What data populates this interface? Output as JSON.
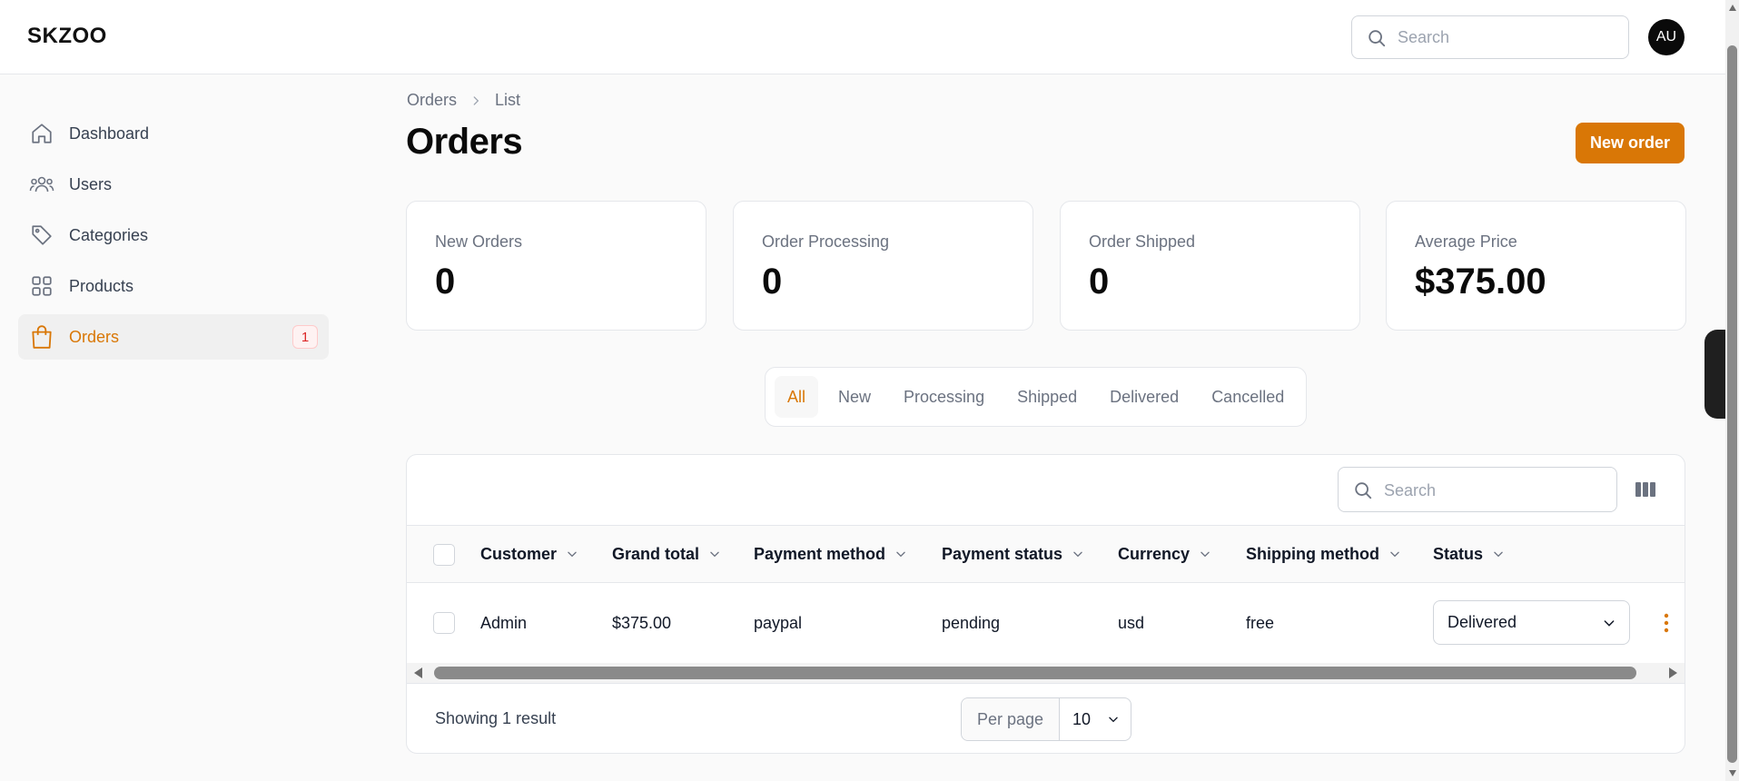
{
  "app": {
    "brand": "SKZOO",
    "avatar_initials": "AU"
  },
  "search": {
    "placeholder": "Search"
  },
  "sidebar": {
    "items": [
      {
        "label": "Dashboard",
        "icon": "home-icon"
      },
      {
        "label": "Users",
        "icon": "users-icon"
      },
      {
        "label": "Categories",
        "icon": "tag-icon"
      },
      {
        "label": "Products",
        "icon": "grid-icon"
      },
      {
        "label": "Orders",
        "icon": "shopping-bag-icon",
        "badge": "1",
        "active": true
      }
    ]
  },
  "breadcrumb": {
    "items": [
      "Orders",
      "List"
    ]
  },
  "page": {
    "title": "Orders",
    "new_button": "New order"
  },
  "stats": [
    {
      "label": "New Orders",
      "value": "0"
    },
    {
      "label": "Order Processing",
      "value": "0"
    },
    {
      "label": "Order Shipped",
      "value": "0"
    },
    {
      "label": "Average Price",
      "value": "$375.00"
    }
  ],
  "tabs": {
    "items": [
      "All",
      "New",
      "Processing",
      "Shipped",
      "Delivered",
      "Cancelled"
    ],
    "active": "All"
  },
  "table": {
    "search_placeholder": "Search",
    "columns": [
      "Customer",
      "Grand total",
      "Payment method",
      "Payment status",
      "Currency",
      "Shipping method",
      "Status"
    ],
    "rows": [
      {
        "customer": "Admin",
        "grand_total": "$375.00",
        "payment_method": "paypal",
        "payment_status": "pending",
        "currency": "usd",
        "shipping_method": "free",
        "status": "Delivered"
      }
    ],
    "footer": {
      "result_text": "Showing 1 result",
      "per_page_label": "Per page",
      "per_page_value": "10"
    }
  },
  "colors": {
    "accent": "#d97706",
    "badge": "#dc2626",
    "border": "#e5e7eb",
    "text": "#111827",
    "muted": "#6b7280"
  }
}
